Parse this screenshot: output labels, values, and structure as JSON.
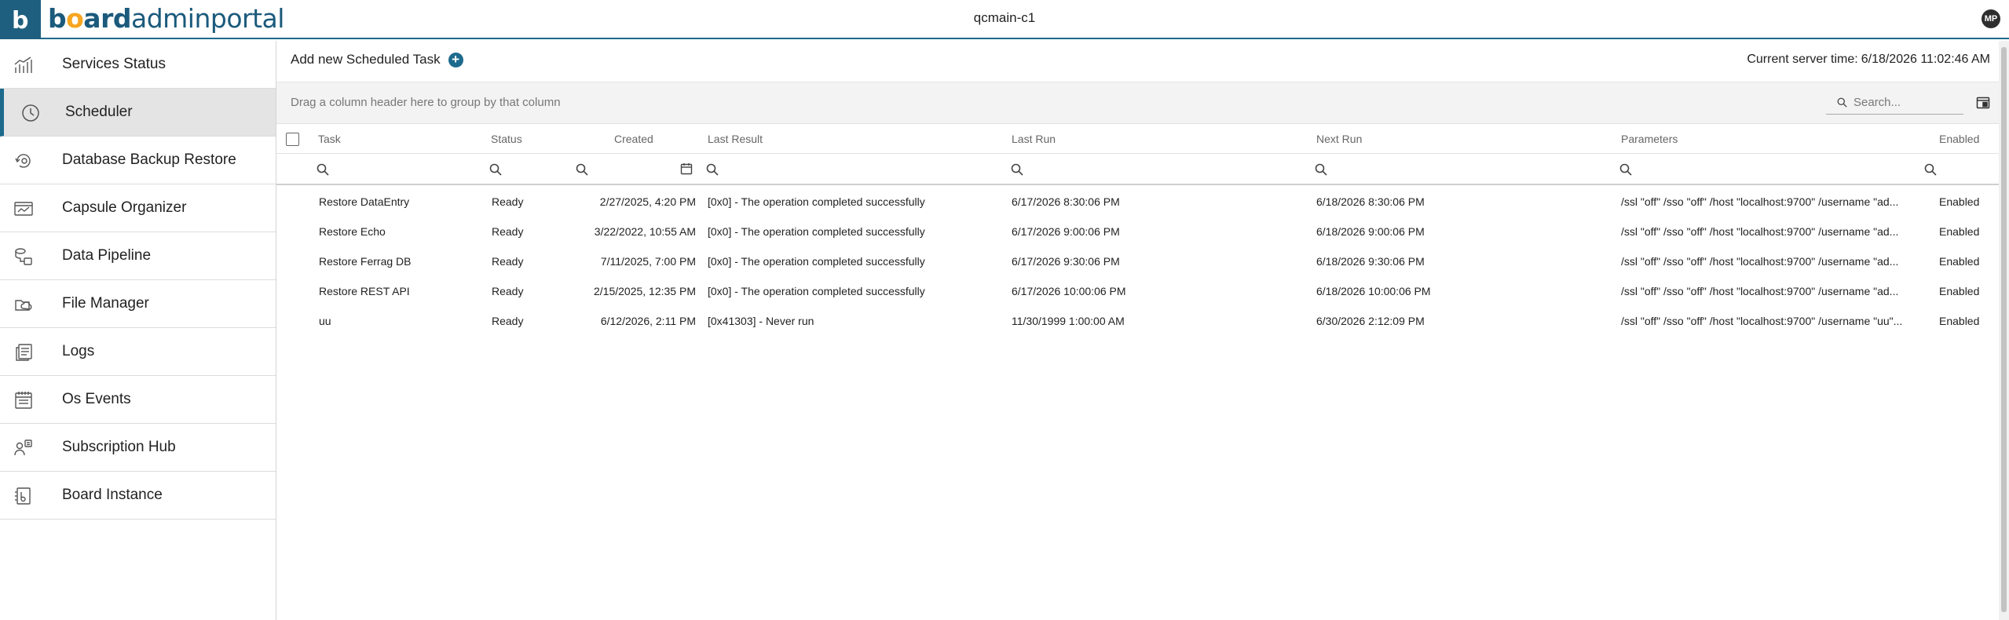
{
  "header": {
    "logo_letter": "b",
    "brand_bold_prefix": "b",
    "brand_bold_dot": "o",
    "brand_bold_suffix": "ard",
    "brand_light": "adminportal",
    "title": "qcmain-c1",
    "user_initials": "MP"
  },
  "colors": {
    "accent": "#1d6a8d",
    "logo_bg": "#1e5f7f",
    "brand_dot": "#f6a620"
  },
  "sidebar": {
    "items": [
      {
        "label": "Services Status",
        "icon": "chart-bars-icon",
        "active": false
      },
      {
        "label": "Scheduler",
        "icon": "clock-icon",
        "active": true
      },
      {
        "label": "Database Backup Restore",
        "icon": "backup-restore-icon",
        "active": false
      },
      {
        "label": "Capsule Organizer",
        "icon": "capsule-icon",
        "active": false
      },
      {
        "label": "Data Pipeline",
        "icon": "pipeline-icon",
        "active": false
      },
      {
        "label": "File Manager",
        "icon": "folder-cloud-icon",
        "active": false
      },
      {
        "label": "Logs",
        "icon": "logs-icon",
        "active": false
      },
      {
        "label": "Os Events",
        "icon": "calendar-list-icon",
        "active": false
      },
      {
        "label": "Subscription Hub",
        "icon": "subscription-icon",
        "active": false
      },
      {
        "label": "Board Instance",
        "icon": "board-instance-icon",
        "active": false
      }
    ]
  },
  "toolbar": {
    "add_task_label": "Add new Scheduled Task",
    "server_time_label": "Current server time:",
    "server_time_value": "6/18/2026 11:02:46 AM"
  },
  "grid": {
    "group_hint": "Drag a column header here to group by that column",
    "search_placeholder": "Search...",
    "columns": [
      "Task",
      "Status",
      "Created",
      "Last Result",
      "Last Run",
      "Next Run",
      "Parameters",
      "Enabled"
    ],
    "rows": [
      {
        "task": "Restore DataEntry",
        "status": "Ready",
        "created": "2/27/2025, 4:20 PM",
        "last_result": "[0x0] - The operation completed successfully",
        "last_run": "6/17/2026 8:30:06 PM",
        "next_run": "6/18/2026 8:30:06 PM",
        "parameters": "/ssl \"off\" /sso \"off\" /host \"localhost:9700\" /username \"ad...",
        "enabled": "Enabled"
      },
      {
        "task": "Restore Echo",
        "status": "Ready",
        "created": "3/22/2022, 10:55 AM",
        "last_result": "[0x0] - The operation completed successfully",
        "last_run": "6/17/2026 9:00:06 PM",
        "next_run": "6/18/2026 9:00:06 PM",
        "parameters": "/ssl \"off\" /sso \"off\" /host \"localhost:9700\" /username \"ad...",
        "enabled": "Enabled"
      },
      {
        "task": "Restore Ferrag DB",
        "status": "Ready",
        "created": "7/11/2025, 7:00 PM",
        "last_result": "[0x0] - The operation completed successfully",
        "last_run": "6/17/2026 9:30:06 PM",
        "next_run": "6/18/2026 9:30:06 PM",
        "parameters": "/ssl \"off\" /sso \"off\" /host \"localhost:9700\" /username \"ad...",
        "enabled": "Enabled"
      },
      {
        "task": "Restore REST API",
        "status": "Ready",
        "created": "2/15/2025, 12:35 PM",
        "last_result": "[0x0] - The operation completed successfully",
        "last_run": "6/17/2026 10:00:06 PM",
        "next_run": "6/18/2026 10:00:06 PM",
        "parameters": "/ssl \"off\" /sso \"off\" /host \"localhost:9700\" /username \"ad...",
        "enabled": "Enabled"
      },
      {
        "task": "uu",
        "status": "Ready",
        "created": "6/12/2026, 2:11 PM",
        "last_result": "[0x41303] - Never run",
        "last_run": "11/30/1999 1:00:00 AM",
        "next_run": "6/30/2026 2:12:09 PM",
        "parameters": "/ssl \"off\" /sso \"off\" /host \"localhost:9700\" /username \"uu\"...",
        "enabled": "Enabled"
      }
    ]
  }
}
